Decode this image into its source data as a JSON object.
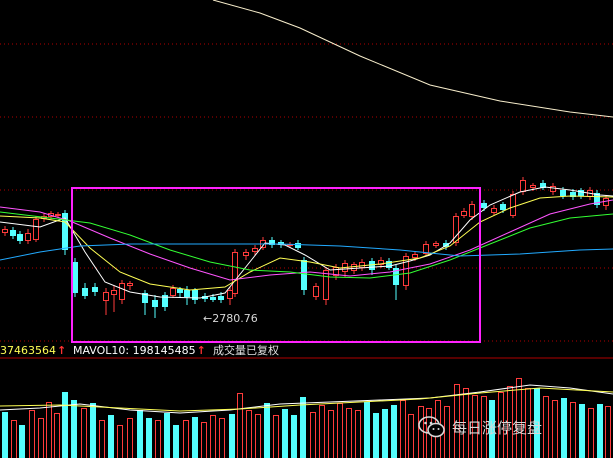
{
  "low_marker": {
    "text": "←2780.76"
  },
  "volume_bar": {
    "vol_partial": "37463564",
    "mavol_label": "MAVOL10: 198145485",
    "status": "成交量已复权"
  },
  "watermark": {
    "text": "每日涨停复盘",
    "icon": "wechat-icon"
  },
  "colors": {
    "background": "#000000",
    "up": "#ff3b3b",
    "down": "#54ffff",
    "grid": "#b00000",
    "highlight_box": "#ff22ff",
    "ma_white": "#ffffff",
    "ma_yellow": "#ffff55",
    "ma_magenta": "#ff55ff",
    "ma_green": "#33ff33",
    "ma_cyan": "#22aaff"
  }
}
